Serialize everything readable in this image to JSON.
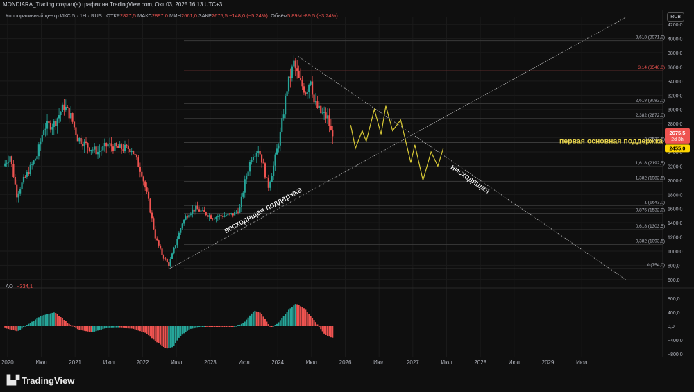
{
  "header": {
    "title": "MONDIARA_Trading создал(а) график на TradingView.com, Окт 03, 2025 16:13 UTC+3",
    "instrument": "Корпоративный центр ИКС 5 · 1Н · RUS",
    "open_label": "ОТКР",
    "open": "2827,5",
    "high_label": "МАКС",
    "high": "2897,0",
    "low_label": "МИН",
    "low": "2661,0",
    "close_label": "ЗАКР",
    "close": "2675,5",
    "change": "−148,0 (−5,24%)",
    "volume_label": "Объём",
    "volume": "5,89M",
    "volume_change": "-89,5 (−3,24%)",
    "currency": "RUB"
  },
  "brand": "TradingView",
  "colors": {
    "up": "#26a69a",
    "down": "#ef5350",
    "background": "#0f0f0f",
    "forecast": "#d8c936",
    "support": "#e8d44d"
  },
  "chart_data": {
    "type": "candlestick",
    "price_axis": {
      "range": [
        500,
        4300
      ],
      "ticks": [
        "600,0",
        "800,0",
        "1000,0",
        "1200,0",
        "1400,0",
        "1600,0",
        "1800,0",
        "2000,0",
        "2200,0",
        "2400,0",
        "2600,0",
        "2800,0",
        "3000,0",
        "3200,0",
        "3400,0",
        "3600,0",
        "3800,0",
        "4000,0",
        "4200,0"
      ]
    },
    "time_axis": {
      "ticks": [
        "2020",
        "Июл",
        "2021",
        "Июл",
        "2022",
        "Июл",
        "2023",
        "Июл",
        "2024",
        "Июл",
        "2026",
        "Июл",
        "2027",
        "Июл",
        "2028",
        "Июл",
        "2029",
        "Июл"
      ]
    },
    "price_path": [
      [
        2020.0,
        2200
      ],
      [
        2020.1,
        2350
      ],
      [
        2020.2,
        1800
      ],
      [
        2020.3,
        2000
      ],
      [
        2020.5,
        2350
      ],
      [
        2020.6,
        2750
      ],
      [
        2020.75,
        2800
      ],
      [
        2020.9,
        3050
      ],
      [
        2021.0,
        2900
      ],
      [
        2021.1,
        2600
      ],
      [
        2021.25,
        2480
      ],
      [
        2021.4,
        2400
      ],
      [
        2021.55,
        2500
      ],
      [
        2021.7,
        2450
      ],
      [
        2021.9,
        2450
      ],
      [
        2022.05,
        2100
      ],
      [
        2022.15,
        1700
      ],
      [
        2022.25,
        1200
      ],
      [
        2022.35,
        950
      ],
      [
        2022.45,
        800
      ],
      [
        2022.55,
        1100
      ],
      [
        2022.65,
        1400
      ],
      [
        2022.75,
        1550
      ],
      [
        2022.85,
        1600
      ],
      [
        2022.95,
        1550
      ],
      [
        2023.1,
        1480
      ],
      [
        2023.25,
        1500
      ],
      [
        2023.4,
        1520
      ],
      [
        2023.5,
        1600
      ],
      [
        2023.58,
        2000
      ],
      [
        2023.68,
        2350
      ],
      [
        2023.78,
        2450
      ],
      [
        2023.85,
        2200
      ],
      [
        2023.92,
        1900
      ],
      [
        2024.0,
        2200
      ],
      [
        2024.1,
        2650
      ],
      [
        2024.2,
        3300
      ],
      [
        2024.3,
        3650
      ],
      [
        2024.38,
        3400
      ],
      [
        2024.48,
        3250
      ],
      [
        2024.55,
        3450
      ],
      [
        2024.6,
        3100
      ],
      [
        2024.7,
        2950
      ],
      [
        2024.8,
        2880
      ],
      [
        2024.85,
        2675
      ]
    ],
    "last_price": "2675,5",
    "last_price_time": "2d 3h",
    "support_price": "2455,0",
    "fibonacci": [
      {
        "level": "0",
        "price": "754,0"
      },
      {
        "level": "0,382",
        "price": "1093,5"
      },
      {
        "level": "0,618",
        "price": "1303,5"
      },
      {
        "level": "0,875",
        "price": "1532,0"
      },
      {
        "level": "1",
        "price": "1643,0"
      },
      {
        "level": "1,382",
        "price": "1982,5"
      },
      {
        "level": "1,618",
        "price": "2192,5"
      },
      {
        "level": "2",
        "price": "2532,5"
      },
      {
        "level": "2,382",
        "price": "2872,0"
      },
      {
        "level": "2,618",
        "price": "3082,0"
      },
      {
        "level": "3,14",
        "price": "3546,0"
      },
      {
        "level": "3,618",
        "price": "3971,0"
      }
    ],
    "trendlines": [
      {
        "label": "восходящая поддержка",
        "from": [
          2022.45,
          754
        ],
        "to": [
          2029.2,
          4300
        ]
      },
      {
        "label": "нисходящая",
        "from": [
          2024.35,
          3750
        ],
        "to": [
          2029.2,
          600
        ]
      }
    ],
    "forecast_path": [
      [
        2025.13,
        2780
      ],
      [
        2025.2,
        2450
      ],
      [
        2025.3,
        2700
      ],
      [
        2025.36,
        2550
      ],
      [
        2025.48,
        3000
      ],
      [
        2025.58,
        2650
      ],
      [
        2025.65,
        3050
      ],
      [
        2025.75,
        2700
      ],
      [
        2025.87,
        2850
      ],
      [
        2026.02,
        2250
      ],
      [
        2026.08,
        2500
      ],
      [
        2026.2,
        2000
      ],
      [
        2026.32,
        2400
      ],
      [
        2026.42,
        2200
      ],
      [
        2026.5,
        2450
      ]
    ],
    "annotations": {
      "support_label": "первая основная поддержка"
    },
    "oscillator": {
      "name": "AO",
      "value": "−334,1",
      "axis_ticks": [
        "800,0",
        "400,0",
        "0,0",
        "−400,0",
        "−800,0"
      ],
      "range": [
        -900,
        900
      ],
      "series": [
        [
          2020.0,
          -50
        ],
        [
          2020.2,
          -150
        ],
        [
          2020.35,
          50
        ],
        [
          2020.55,
          300
        ],
        [
          2020.75,
          400
        ],
        [
          2020.95,
          80
        ],
        [
          2021.1,
          -100
        ],
        [
          2021.3,
          -180
        ],
        [
          2021.5,
          -60
        ],
        [
          2021.7,
          -50
        ],
        [
          2021.9,
          -70
        ],
        [
          2022.1,
          -200
        ],
        [
          2022.25,
          -450
        ],
        [
          2022.4,
          -650
        ],
        [
          2022.5,
          -600
        ],
        [
          2022.6,
          -300
        ],
        [
          2022.75,
          -80
        ],
        [
          2022.95,
          -20
        ],
        [
          2023.2,
          -30
        ],
        [
          2023.4,
          -40
        ],
        [
          2023.55,
          100
        ],
        [
          2023.7,
          450
        ],
        [
          2023.8,
          380
        ],
        [
          2023.95,
          -50
        ],
        [
          2024.05,
          80
        ],
        [
          2024.2,
          450
        ],
        [
          2024.32,
          650
        ],
        [
          2024.45,
          500
        ],
        [
          2024.6,
          150
        ],
        [
          2024.75,
          -250
        ],
        [
          2024.85,
          -334
        ]
      ]
    }
  }
}
